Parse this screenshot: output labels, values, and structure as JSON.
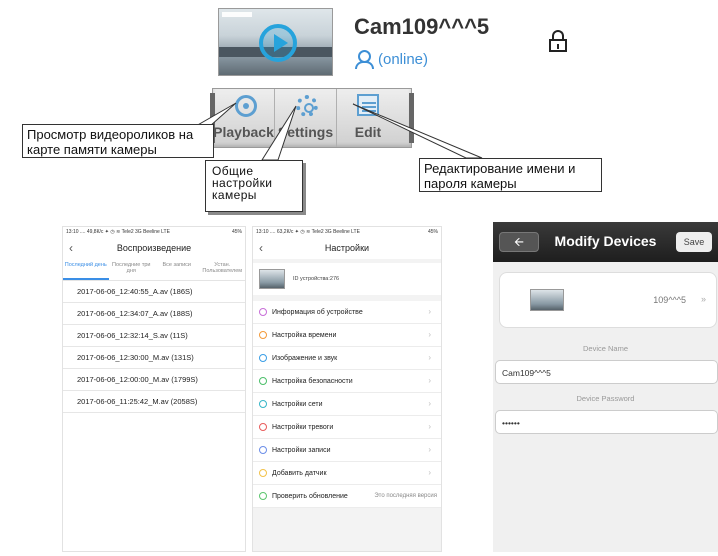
{
  "camera": {
    "name": "Cam109^^^5",
    "status": "(online)",
    "lock_icon": "unlock-icon",
    "thumb_icon": "play-icon"
  },
  "action_bar": {
    "buttons": [
      {
        "label": "Playback",
        "icon": "playback-icon"
      },
      {
        "label": "Settings",
        "icon": "settings-gear-icon"
      },
      {
        "label": "Edit",
        "icon": "edit-icon"
      }
    ]
  },
  "callouts": {
    "playback": "Просмотр видеороликов на карте памяти камеры",
    "settings": "Общие настройки камеры",
    "edit": "Редактирование имени и пароля камеры"
  },
  "playback_screen": {
    "status_left": "13:10 .... 49,8К/с ✦ ◷ ≋ Tele2 3G Beeline LTE",
    "status_right": "45%",
    "title": "Воспроизведение",
    "tabs": [
      "Последний день",
      "Последние три дня",
      "Все записи",
      "Устан. Пользователем"
    ],
    "records": [
      "2017-06-06_12:40:55_A.av (186S)",
      "2017-06-06_12:34:07_A.av (188S)",
      "2017-06-06_12:32:14_S.av (11S)",
      "2017-06-06_12:30:00_M.av (131S)",
      "2017-06-06_12:00:00_M.av (1799S)",
      "2017-06-06_11:25:42_M.av (2058S)"
    ]
  },
  "settings_screen": {
    "status_left": "13:10 .... 63,2К/с ✦ ◷ ≋ Tele2 3G Beeline LTE",
    "status_right": "45%",
    "title": "Настройки",
    "device_id": "ID устройства:276",
    "items": [
      {
        "label": "Информация об устройстве",
        "color": "#c86ed8"
      },
      {
        "label": "Настройка времени",
        "color": "#f39a3a"
      },
      {
        "label": "Изображение и звук",
        "color": "#3a9ee6"
      },
      {
        "label": "Настройка безопасности",
        "color": "#4cbf6a"
      },
      {
        "label": "Настройки сети",
        "color": "#36b6c8"
      },
      {
        "label": "Настройки тревоги",
        "color": "#e95b5b"
      },
      {
        "label": "Настройки записи",
        "color": "#6c8ee8"
      },
      {
        "label": "Добавить датчик",
        "color": "#f2c24a"
      },
      {
        "label": "Проверить обновление",
        "color": "#5cc66e"
      }
    ],
    "update_note": "Это последняя версия"
  },
  "modify_screen": {
    "title": "Modify Devices",
    "save": "Save",
    "device_id": "109^^^5",
    "name_label": "Device Name",
    "name_value": "Cam109^^^5",
    "password_label": "Device Password",
    "password_value": "••••••"
  }
}
